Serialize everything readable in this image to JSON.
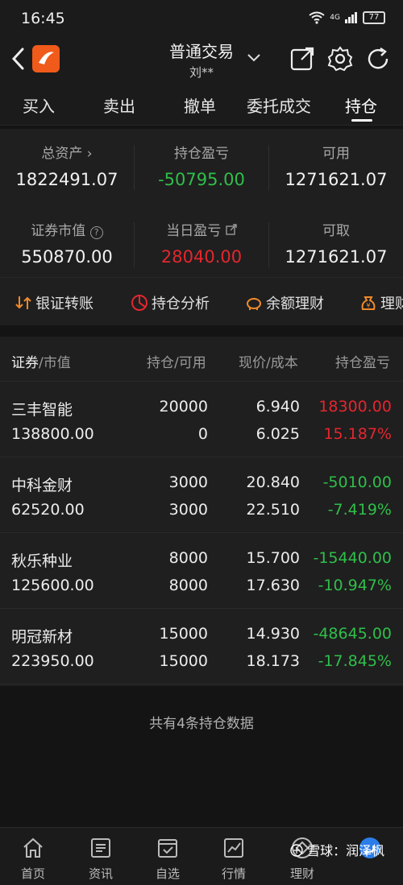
{
  "status": {
    "time": "16:45",
    "battery": "77",
    "network": "4G"
  },
  "header": {
    "title": "普通交易",
    "account": "刘**"
  },
  "tabs": [
    "买入",
    "卖出",
    "撤单",
    "委托成交",
    "持仓"
  ],
  "summary": {
    "total_assets_label": "总资产 ›",
    "total_assets": "1822491.07",
    "position_pl_label": "持仓盈亏",
    "position_pl": "-50795.00",
    "available_label": "可用",
    "available": "1271621.07",
    "market_value_label": "证券市值",
    "market_value": "550870.00",
    "daily_pl_label": "当日盈亏",
    "daily_pl": "28040.00",
    "withdrawable_label": "可取",
    "withdrawable": "1271621.07"
  },
  "quick_actions": [
    "银证转账",
    "持仓分析",
    "余额理财",
    "理财"
  ],
  "table": {
    "headers": [
      "证券",
      "/市值",
      "持仓/可用",
      "现价/成本",
      "持仓盈亏"
    ],
    "rows": [
      {
        "name": "三丰智能",
        "market_value": "138800.00",
        "position": "20000",
        "available": "0",
        "price": "6.940",
        "cost": "6.025",
        "pl": "18300.00",
        "pl_pct": "15.187%",
        "color": "#e4262e"
      },
      {
        "name": "中科金财",
        "market_value": "62520.00",
        "position": "3000",
        "available": "3000",
        "price": "20.840",
        "cost": "22.510",
        "pl": "-5010.00",
        "pl_pct": "-7.419%",
        "color": "#2fbf4a"
      },
      {
        "name": "秋乐种业",
        "market_value": "125600.00",
        "position": "8000",
        "available": "8000",
        "price": "15.700",
        "cost": "17.630",
        "pl": "-15440.00",
        "pl_pct": "-10.947%",
        "color": "#2fbf4a"
      },
      {
        "name": "明冠新材",
        "market_value": "223950.00",
        "position": "15000",
        "available": "15000",
        "price": "14.930",
        "cost": "18.173",
        "pl": "-48645.00",
        "pl_pct": "-17.845%",
        "color": "#2fbf4a"
      }
    ],
    "footer": "共有4条持仓数据"
  },
  "nav": [
    "首页",
    "资讯",
    "自选",
    "行情",
    "理财"
  ],
  "watermark": "雪球：润泽枫",
  "colors": {
    "up": "#e4262e",
    "down": "#2fbf4a",
    "accent": "#2b7de9",
    "brand": "#f05a1a"
  }
}
